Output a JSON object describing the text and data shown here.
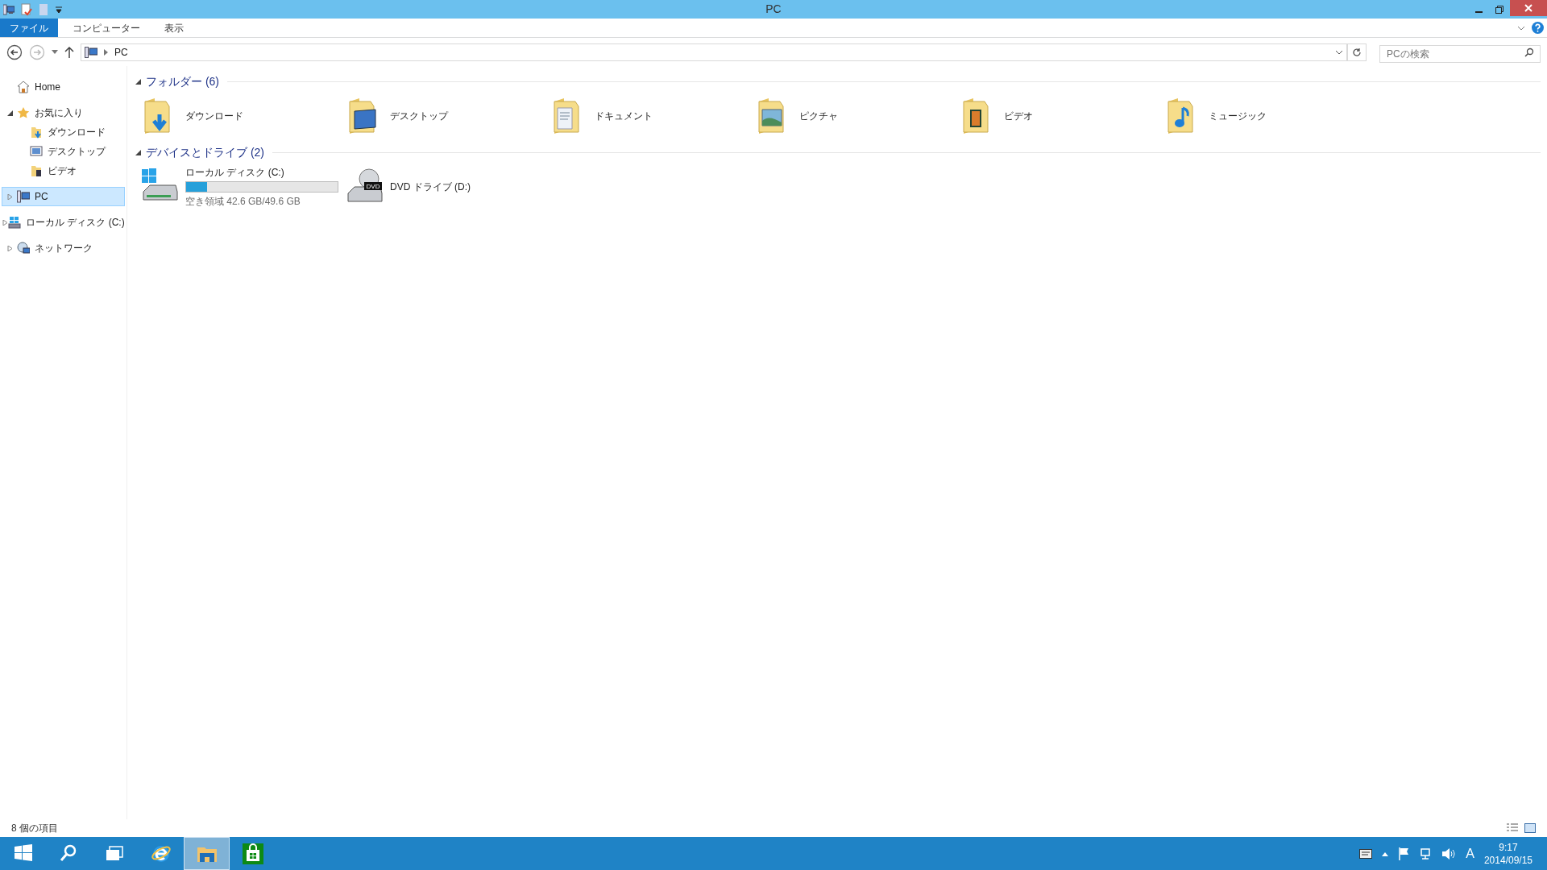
{
  "window": {
    "title": "PC"
  },
  "ribbon": {
    "tabs": [
      {
        "label": "ファイル",
        "selected": true
      },
      {
        "label": "コンピューター",
        "selected": false
      },
      {
        "label": "表示",
        "selected": false
      }
    ]
  },
  "address_bar": {
    "path": [
      "PC"
    ]
  },
  "search": {
    "placeholder": "PCの検索"
  },
  "navigation": [
    {
      "label": "Home",
      "kind": "home",
      "selected": false
    },
    {
      "label": "お気に入り",
      "kind": "star",
      "selected": false,
      "expanded": true,
      "children": [
        {
          "label": "ダウンロード",
          "kind": "download",
          "selected": false
        },
        {
          "label": "デスクトップ",
          "kind": "desktop",
          "selected": false
        },
        {
          "label": "ビデオ",
          "kind": "video",
          "selected": false
        }
      ]
    },
    {
      "label": "PC",
      "kind": "pc",
      "selected": true,
      "expanded": false
    },
    {
      "label": "ローカル ディスク (C:)",
      "kind": "disk",
      "selected": false,
      "expanded": false
    },
    {
      "label": "ネットワーク",
      "kind": "network",
      "selected": false,
      "expanded": false
    }
  ],
  "groups": [
    {
      "title": "フォルダー (6)",
      "expanded": true,
      "items": [
        {
          "kind": "download",
          "label": "ダウンロード"
        },
        {
          "kind": "desktop",
          "label": "デスクトップ"
        },
        {
          "kind": "documents",
          "label": "ドキュメント"
        },
        {
          "kind": "pictures",
          "label": "ピクチャ"
        },
        {
          "kind": "video",
          "label": "ビデオ"
        },
        {
          "kind": "music",
          "label": "ミュージック"
        }
      ]
    },
    {
      "title": "デバイスとドライブ (2)",
      "expanded": true,
      "items": [
        {
          "kind": "disk",
          "label": "ローカル ディスク (C:)",
          "level": 0.14,
          "detail": "空き領域 42.6 GB/49.6 GB"
        },
        {
          "kind": "dvd",
          "label": "DVD ドライブ (D:)",
          "badge": "DVD"
        }
      ]
    }
  ],
  "status_bar": {
    "text": "8 個の項目"
  },
  "taskbar": {
    "apps": [
      {
        "kind": "start",
        "selected": false
      },
      {
        "kind": "search",
        "selected": false
      },
      {
        "kind": "taskview",
        "selected": false
      },
      {
        "kind": "browser",
        "selected": false
      },
      {
        "kind": "explorer",
        "selected": true
      },
      {
        "kind": "store",
        "selected": false
      }
    ],
    "ime": "A",
    "time": "9:17",
    "date": "2014/09/15"
  }
}
